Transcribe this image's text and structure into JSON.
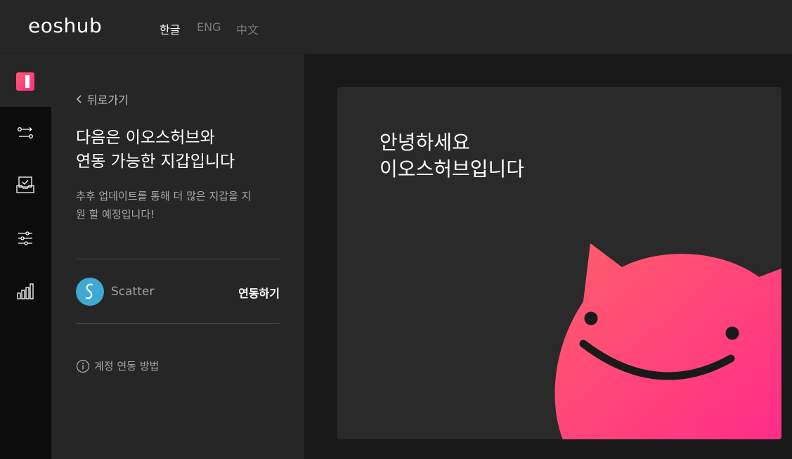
{
  "header": {
    "logo": "eoshub",
    "languages": [
      {
        "label": "한글",
        "active": true
      },
      {
        "label": "ENG",
        "active": false
      },
      {
        "label": "中文",
        "active": false
      }
    ]
  },
  "rail": {
    "icons": [
      "brand-square-icon",
      "transfer-icon",
      "inbox-check-icon",
      "sliders-icon",
      "bar-chart-icon"
    ]
  },
  "panel": {
    "back_label": "뒤로가기",
    "title_line1": "다음은 이오스허브와",
    "title_line2": "연동 가능한 지갑입니다",
    "desc_line1": "추후 업데이트를 통해 더 많은 지갑을 지",
    "desc_line2": "원 할 예정입니다!",
    "wallet": {
      "name": "Scatter",
      "action_label": "연동하기"
    },
    "help_label": "계정 연동 방법"
  },
  "card": {
    "greeting_line1": "안녕하세요",
    "greeting_line2": "이오스허브입니다"
  },
  "colors": {
    "accent_pink": "#ff2d87",
    "accent_coral": "#ff5a6e",
    "scatter_blue": "#40a9d3"
  }
}
